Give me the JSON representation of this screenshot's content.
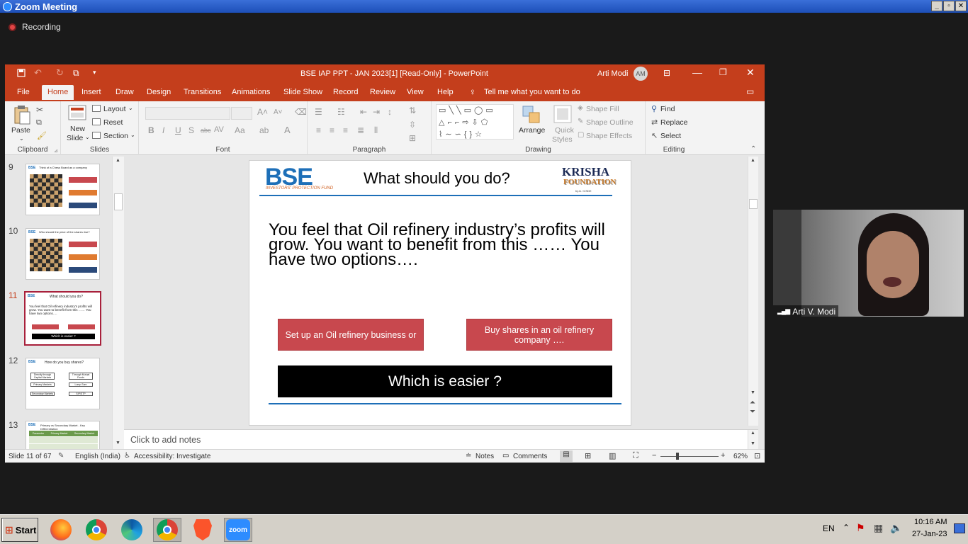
{
  "zoom": {
    "window_title": "Zoom Meeting",
    "recording_label": "Recording"
  },
  "ppt": {
    "title": "BSE IAP PPT - JAN 2023[1] [Read-Only] - PowerPoint",
    "user_name": "Arti Modi",
    "user_initials": "AM",
    "tabs": [
      "File",
      "Home",
      "Insert",
      "Draw",
      "Design",
      "Transitions",
      "Animations",
      "Slide Show",
      "Record",
      "Review",
      "View",
      "Help"
    ],
    "tell_me": "Tell me what you want to do",
    "ribbon": {
      "clipboard": {
        "paste": "Paste",
        "label": "Clipboard"
      },
      "slides": {
        "new_slide_1": "New",
        "new_slide_2": "Slide",
        "layout": "Layout",
        "reset": "Reset",
        "section": "Section",
        "label": "Slides"
      },
      "font": {
        "label": "Font"
      },
      "paragraph": {
        "label": "Paragraph"
      },
      "drawing": {
        "arrange": "Arrange",
        "quick_styles_1": "Quick",
        "quick_styles_2": "Styles",
        "shape_fill": "Shape Fill",
        "shape_outline": "Shape Outline",
        "shape_effects": "Shape Effects",
        "label": "Drawing"
      },
      "editing": {
        "find": "Find",
        "replace": "Replace",
        "select": "Select",
        "label": "Editing"
      }
    },
    "thumbnails": [
      {
        "num": "9",
        "title": "Think of a Chess Board as a company"
      },
      {
        "num": "10",
        "title": "Who should the price of the shares rise?"
      },
      {
        "num": "11",
        "title": "What should you do?",
        "body": "You feel that Oil refinery industry's profits will grow. You want to benefit from this …… You have two options….",
        "box": "Which is easier ?"
      },
      {
        "num": "12",
        "title": "How do you buy shares?",
        "items": [
          "Directly through Capital Markets",
          "Through Mutual Funds",
          "Primary Markets",
          "Lump Sum",
          "Secondary Markets",
          "SIP/STP"
        ]
      },
      {
        "num": "13",
        "title": "Primary vs Secondary Market - Key Differentiation",
        "headers": [
          "Parameter",
          "Primary Market",
          "Secondary Market"
        ]
      }
    ],
    "slide": {
      "bse_logo": "BSE",
      "bse_sub": "INVESTORS' PROTECTION FUND",
      "title": "What should you do?",
      "krisha_1": "KRISHA",
      "krisha_2": "FOUNDATION",
      "krisha_3": "by.in. ICSDE",
      "body": "You feel that Oil refinery industry’s profits will grow. You want to benefit from this …… You have two options….",
      "option_1": "Set up an Oil refinery business or",
      "option_2": "Buy shares in an oil refinery company ….",
      "question": "Which is easier ?"
    },
    "notes_placeholder": "Click to add notes",
    "status": {
      "slide_count": "Slide 11 of 67",
      "language": "English (India)",
      "accessibility": "Accessibility: Investigate",
      "notes": "Notes",
      "comments": "Comments",
      "zoom": "62%"
    }
  },
  "video": {
    "participant": "Arti V. Modi"
  },
  "taskbar": {
    "start": "Start",
    "lang": "EN",
    "time": "10:16 AM",
    "date": "27-Jan-23",
    "zoom_app": "zoom"
  },
  "colors": {
    "ppt_accent": "#c43e1c",
    "slide_red": "#c8484e",
    "bse_blue": "#1d6fb8"
  }
}
